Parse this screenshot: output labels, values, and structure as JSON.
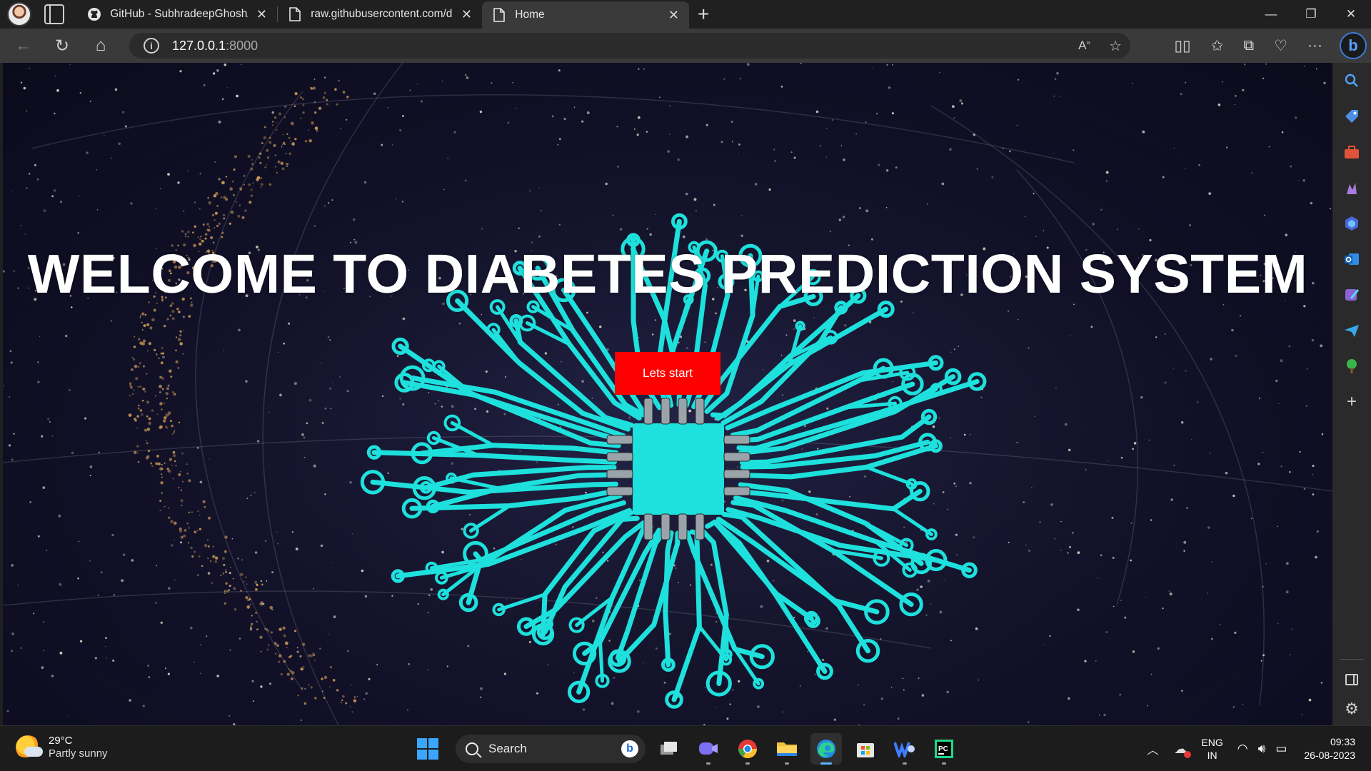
{
  "browser": {
    "tabs": [
      {
        "label": "GitHub - SubhradeepGhosh/Diat",
        "icon": "github-icon",
        "active": false
      },
      {
        "label": "raw.githubusercontent.com/dphi",
        "icon": "page-icon",
        "active": false
      },
      {
        "label": "Home",
        "icon": "page-icon",
        "active": true
      }
    ],
    "address": {
      "host": "127.0.0.1",
      "port": ":8000"
    }
  },
  "page": {
    "title": "WELCOME TO DIABETES PREDICTION SYSTEM",
    "start_button": "Lets start"
  },
  "taskbar": {
    "weather": {
      "temp": "29°C",
      "condition": "Partly sunny"
    },
    "search_label": "Search",
    "lang": {
      "line1": "ENG",
      "line2": "IN"
    },
    "time": "09:33",
    "date": "26-08-2023"
  },
  "colors": {
    "accent_button": "#ff0000",
    "circuit": "#1ee0dc",
    "background": "#12112a"
  }
}
